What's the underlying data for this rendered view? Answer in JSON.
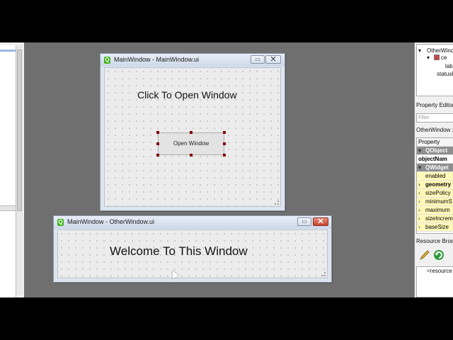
{
  "main_window": {
    "title": "MainWindow - MainWindow.ui",
    "heading": "Click To Open Window",
    "button_label": "Open Window",
    "min_glyph": "▭",
    "max_glyph": "▭▭"
  },
  "other_window": {
    "title": "MainWindow - OtherWindow.ui",
    "heading": "Welcome To This Window",
    "min_glyph": "▭",
    "max_glyph": "▭",
    "close_glyph": "✕"
  },
  "object_inspector": {
    "items": [
      "OtherWindo",
      "ce",
      "lab",
      "statusb"
    ]
  },
  "property_editor": {
    "title": "Property Editor",
    "filter_placeholder": "Filter",
    "object_label": "OtherWindow :",
    "column_header": "Property",
    "rows": [
      {
        "label": "QObject",
        "kind": "group"
      },
      {
        "label": "objectNam",
        "kind": "bold"
      },
      {
        "label": "QWidget",
        "kind": "group"
      },
      {
        "label": "enabled",
        "kind": "yellow"
      },
      {
        "label": "geometry",
        "kind": "yellow-bold-arrow"
      },
      {
        "label": "sizePolicy",
        "kind": "yellow-arrow"
      },
      {
        "label": "minimumS",
        "kind": "yellow-arrow"
      },
      {
        "label": "maximum",
        "kind": "yellow-arrow"
      },
      {
        "label": "sizeIncrem",
        "kind": "yellow-arrow"
      },
      {
        "label": "baseSize",
        "kind": "yellow-arrow"
      }
    ]
  },
  "resource_browser": {
    "title": "Resource Brows",
    "root_label": "<resource"
  },
  "colors": {
    "desktop": "#6f6f6f",
    "handle": "#800000",
    "group_row": "#8e8e8e",
    "property_row": "#fff8b8",
    "qt_icon": "#41b41a"
  }
}
